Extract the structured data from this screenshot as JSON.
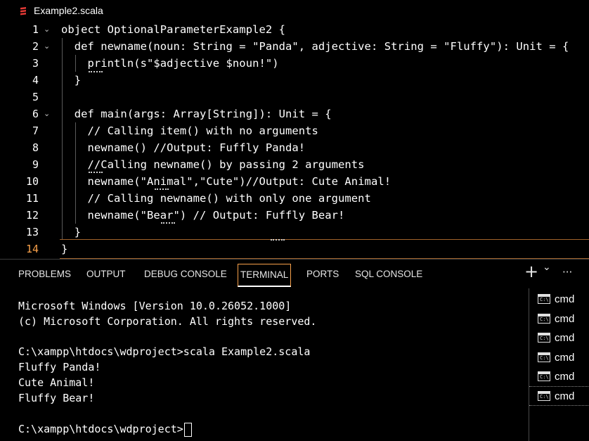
{
  "editor_tab": {
    "filename": "Example2.scala",
    "icon": "scala-icon"
  },
  "editor": {
    "lines": [
      {
        "num": "1",
        "text": "object OptionalParameterExample2 {",
        "fold": true
      },
      {
        "num": "2",
        "text": "  def newname(noun: String = \"Panda\", adjective: String = \"Fluffy\"): Unit = {",
        "fold": true
      },
      {
        "num": "3",
        "text": "    println(s\"$adjective $noun!\")",
        "fold": false
      },
      {
        "num": "4",
        "text": "  }",
        "fold": false
      },
      {
        "num": "5",
        "text": "",
        "fold": false
      },
      {
        "num": "6",
        "text": "  def main(args: Array[String]): Unit = {",
        "fold": true
      },
      {
        "num": "7",
        "text": "    // Calling item() with no arguments",
        "fold": false
      },
      {
        "num": "8",
        "text": "    newname() //Output: Fuffly Panda!",
        "fold": false
      },
      {
        "num": "9",
        "text": "    //Calling newname() by passing 2 arguments",
        "fold": false
      },
      {
        "num": "10",
        "text": "    newname(\"Animal\",\"Cute\")//Output: Cute Animal!",
        "fold": false
      },
      {
        "num": "11",
        "text": "    // Calling newname() with only one argument",
        "fold": false
      },
      {
        "num": "12",
        "text": "    newname(\"Bear\") // Output: Fuffly Bear!",
        "fold": false
      },
      {
        "num": "13",
        "text": "  }",
        "fold": false
      },
      {
        "num": "14",
        "text": "}",
        "fold": false,
        "active": true
      }
    ]
  },
  "panel": {
    "tabs": [
      "PROBLEMS",
      "OUTPUT",
      "DEBUG CONSOLE",
      "TERMINAL",
      "PORTS",
      "SQL CONSOLE"
    ],
    "active_tab": "TERMINAL",
    "actions": {
      "new_terminal": "+",
      "dropdown": "⌄",
      "more": "···"
    }
  },
  "terminal": {
    "lines": [
      "Microsoft Windows [Version 10.0.26052.1000]",
      "(c) Microsoft Corporation. All rights reserved.",
      "",
      "C:\\xampp\\htdocs\\wdproject>scala Example2.scala",
      "Fluffy Panda!",
      "Cute Animal!",
      "Fluffy Bear!",
      "",
      "C:\\xampp\\htdocs\\wdproject>"
    ]
  },
  "terminal_list": {
    "items": [
      {
        "label": "cmd"
      },
      {
        "label": "cmd"
      },
      {
        "label": "cmd"
      },
      {
        "label": "cmd"
      },
      {
        "label": "cmd"
      },
      {
        "label": "cmd",
        "selected": true
      }
    ],
    "icon_text": "C:\\"
  },
  "colors": {
    "active_line_number": "#f7a04a",
    "active_tab_border": "#f7a04a"
  }
}
